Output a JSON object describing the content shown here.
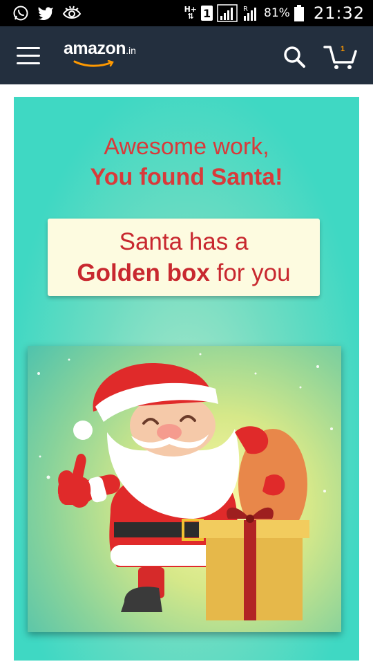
{
  "status_bar": {
    "network": "H+",
    "sim": "1",
    "roaming": "R",
    "battery": "81%",
    "time": "21:32"
  },
  "header": {
    "logo_text": "amazon",
    "logo_suffix": ".in",
    "cart_count": "1"
  },
  "promo": {
    "headline_line1": "Awesome work,",
    "headline_line2": "You found Santa!",
    "note_line1": "Santa has a",
    "note_line2_bold": "Golden box",
    "note_line2_rest": " for you"
  },
  "colors": {
    "header_bg": "#232f3e",
    "card_bg": "#3fd8c3",
    "headline_red": "#d83a3a",
    "note_bg": "#fdfbe0",
    "amazon_orange": "#ff9900"
  },
  "icons": [
    "whatsapp-icon",
    "twitter-icon",
    "eye-icon",
    "signal-icon",
    "battery-icon",
    "menu-icon",
    "search-icon",
    "cart-icon"
  ]
}
